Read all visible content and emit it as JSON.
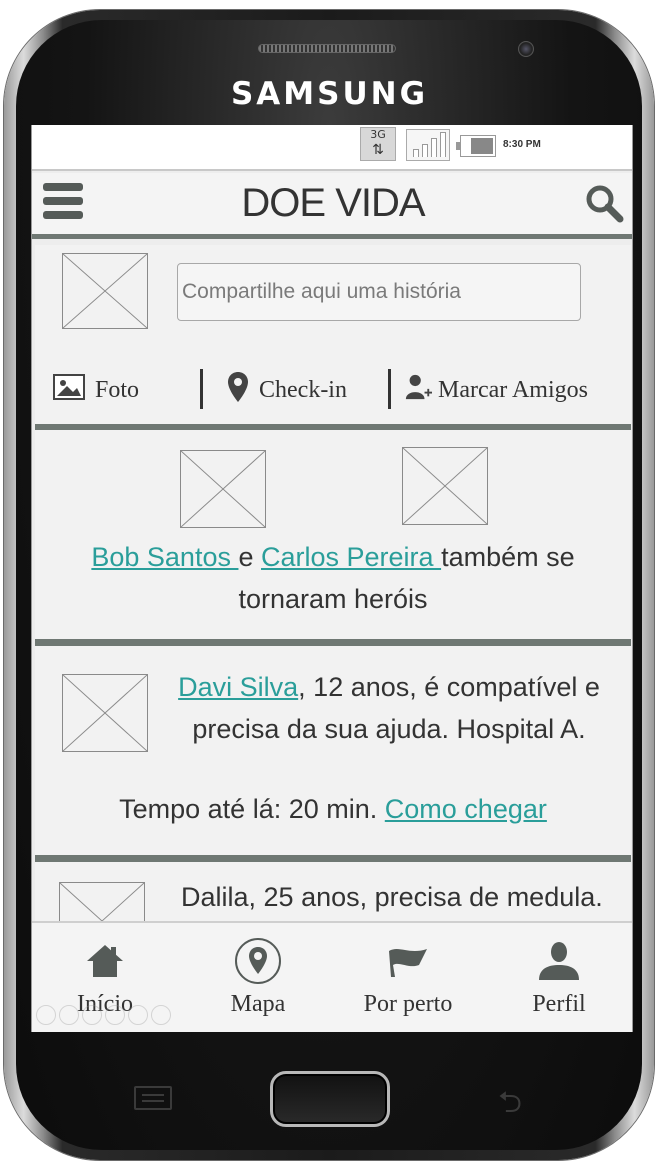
{
  "device": {
    "brand": "SAMSUNG"
  },
  "statusbar": {
    "network": "3G",
    "time": "8:30 PM"
  },
  "header": {
    "title": "DOE VIDA",
    "menu_icon": "hamburger-menu-icon",
    "search_icon": "search-icon"
  },
  "share": {
    "placeholder": "Compartilhe aqui uma história",
    "actions": {
      "photo": "Foto",
      "checkin": "Check-in",
      "tag": "Marcar Amigos"
    }
  },
  "heroes": {
    "name1": "Bob Santos ",
    "connector": "e ",
    "name2": "Carlos Pereira ",
    "rest": "também se tornaram heróis"
  },
  "match": {
    "name": "Davi Silva",
    "rest": ", 12 anos, é compatível e precisa da sua ajuda. Hospital A.",
    "time_label": "Tempo até lá: ",
    "time_value": "20 min.",
    "route_link": "Como chegar"
  },
  "partial_post": {
    "text": "Dalila, 25 anos, precisa de medula."
  },
  "bottomnav": {
    "home": "Início",
    "map": "Mapa",
    "nearby": "Por perto",
    "profile": "Perfil"
  },
  "colors": {
    "link": "#2a9e9a",
    "divider": "#6f7873",
    "screen_bg": "#ededed"
  }
}
